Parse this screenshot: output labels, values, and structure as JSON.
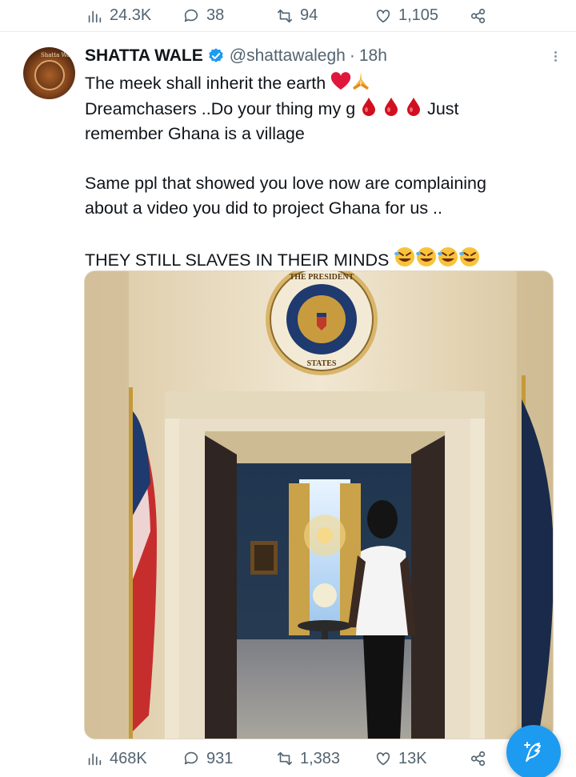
{
  "prev_tweet_actions": {
    "views": "24.3K",
    "replies": "38",
    "retweets": "94",
    "likes": "1,105"
  },
  "tweet": {
    "display_name": "SHATTA WALE",
    "handle": "@shattawalegh",
    "separator": "·",
    "time": "18h",
    "line1": "The meek shall inherit the earth",
    "line2_a": "Dreamchasers ..Do your thing my g",
    "line2_b": "Just",
    "line3": "remember Ghana is a village",
    "para2_line1": "Same ppl that showed you love now are complaining",
    "para2_line2": "about a video you did to project Ghana for us ..",
    "para3": "THEY STILL SLAVES IN THEIR MINDS",
    "seal_text": "SEAL OF THE PRESIDENT OF THE UNITED STATES",
    "avatar_tag": "Shatta Wale"
  },
  "tweet_actions": {
    "views": "468K",
    "replies": "931",
    "retweets": "1,383",
    "likes": "13K"
  },
  "icons": {
    "accent": "#1d9bf0",
    "muted": "#536471"
  }
}
